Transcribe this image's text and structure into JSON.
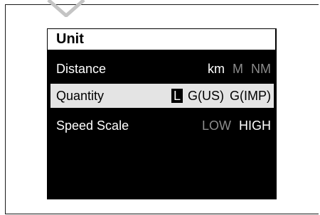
{
  "screen": {
    "title": "Unit",
    "rows": [
      {
        "label": "Distance",
        "options": [
          {
            "text": "km",
            "state": "active"
          },
          {
            "text": "M",
            "state": "inactive"
          },
          {
            "text": "NM",
            "state": "inactive"
          }
        ]
      },
      {
        "label": "Quantity",
        "options": [
          {
            "text": "L",
            "state": "selected"
          },
          {
            "text": "G(US)",
            "state": "normal"
          },
          {
            "text": "G(IMP)",
            "state": "normal"
          }
        ]
      },
      {
        "label": "Speed Scale",
        "options": [
          {
            "text": "LOW",
            "state": "inactive"
          },
          {
            "text": "HIGH",
            "state": "active"
          }
        ]
      }
    ]
  },
  "colors": {
    "screen_background": "#000000",
    "highlight_row": "#e4e4e4",
    "inactive_text": "#8c8c8c",
    "active_text": "#ffffff"
  }
}
